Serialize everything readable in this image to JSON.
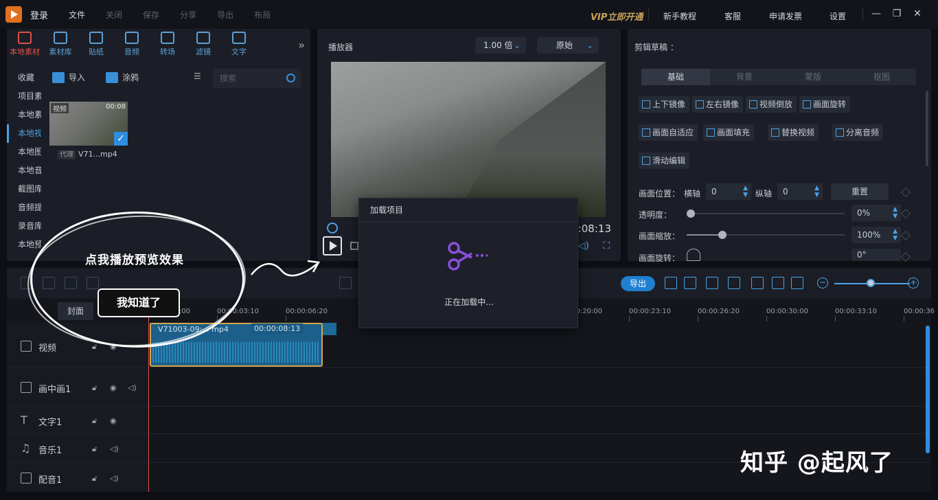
{
  "menubar": {
    "login": "登录",
    "items": [
      "文件",
      "关闭",
      "保存",
      "分享",
      "导出",
      "布局"
    ],
    "vip": "VIP立即开通",
    "right_items": [
      "新手教程",
      "客服",
      "申请发票",
      "设置"
    ]
  },
  "media": {
    "tools": [
      "本地素材",
      "素材库",
      "贴纸",
      "音频",
      "转场",
      "滤镜",
      "文字"
    ],
    "sidebar": [
      "收藏",
      "项目素",
      "本地素",
      "本地视",
      "本地图",
      "本地音",
      "截图库",
      "音频提",
      "录音库",
      "本地预"
    ],
    "import_label": "导入",
    "paint_label": "涂鸦",
    "search_placeholder": "搜索",
    "clip": {
      "tag": "视频",
      "duration": "00:08",
      "proxy": "代理",
      "name": "V71...mp4"
    }
  },
  "player": {
    "title": "播放器",
    "speed": "1.00 倍",
    "ratio": "原始",
    "time": "00:08:13"
  },
  "properties": {
    "title": "剪辑草稿 ：",
    "tabs": [
      "基础",
      "背景",
      "蒙版",
      "抠图"
    ],
    "row1": [
      "上下镜像",
      "左右镜像",
      "视频倒放",
      "画面旋转"
    ],
    "row2": [
      "画面自适应",
      "画面填充",
      "替换视频",
      "分离音频"
    ],
    "row3": [
      "滑动编辑"
    ],
    "position_label": "画面位置：",
    "x_label": "横轴",
    "x_value": "0",
    "y_label": "纵轴",
    "y_value": "0",
    "reset": "重置",
    "opacity_label": "透明度：",
    "opacity_value": "0%",
    "opacity_level": 0,
    "scale_label": "画面缩放：",
    "scale_value": "100%",
    "scale_level": 0.2,
    "rotate_label": "画面旋转：",
    "rotate_value": "0°"
  },
  "timeline": {
    "export": "导出",
    "cover": "封面",
    "ticks": [
      "00:00:00:00",
      "00:00:03:10",
      "00:00:06:20",
      "00:00:20:00",
      "00:00:23:10",
      "00:00:26:20",
      "00:00:30:00",
      "00:00:33:10",
      "00:00:36"
    ],
    "tracks": [
      "视频",
      "画中画1",
      "文字1",
      "音乐1",
      "配音1"
    ],
    "clip_name": "V71003-09:... mp4",
    "clip_duration": "00:00:08:13"
  },
  "annotation": {
    "text": "点我播放预览效果",
    "button": "我知道了"
  },
  "dialog": {
    "title": "加载项目",
    "message": "正在加载中..."
  },
  "watermark": "知乎 @起风了",
  "colors": {
    "accent": "#2f8ee0",
    "danger": "#e0504a",
    "vip": "#c9a35a",
    "dialog_icon": "#8a4fe0"
  }
}
